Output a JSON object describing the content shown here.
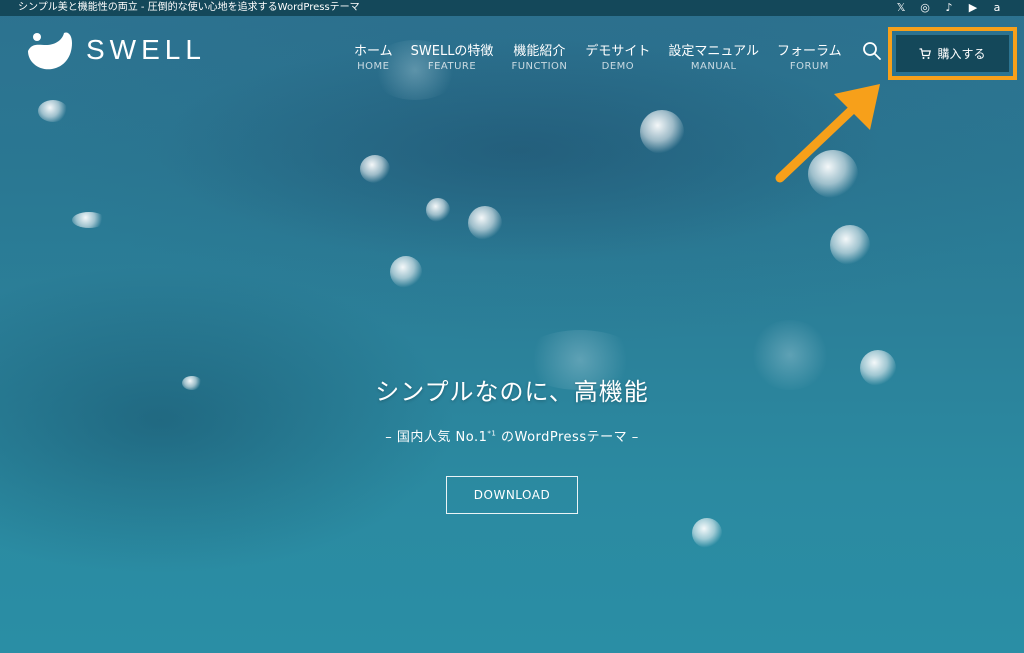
{
  "topbar": {
    "tagline": "シンプル美と機能性の両立 - 圧倒的な使い心地を追求するWordPressテーマ",
    "socials": [
      {
        "icon": "x-icon",
        "glyph": "𝕏"
      },
      {
        "icon": "instagram-icon",
        "glyph": "◎"
      },
      {
        "icon": "tiktok-icon",
        "glyph": "♪"
      },
      {
        "icon": "youtube-icon",
        "glyph": "▶"
      },
      {
        "icon": "amazon-icon",
        "glyph": "a"
      }
    ]
  },
  "header": {
    "logo_text": "SWELL",
    "nav": [
      {
        "jp": "ホーム",
        "en": "HOME"
      },
      {
        "jp": "SWELLの特徴",
        "en": "FEATURE"
      },
      {
        "jp": "機能紹介",
        "en": "FUNCTION"
      },
      {
        "jp": "デモサイト",
        "en": "DEMO"
      },
      {
        "jp": "設定マニュアル",
        "en": "MANUAL"
      },
      {
        "jp": "フォーラム",
        "en": "FORUM"
      }
    ],
    "buy_label": "購入する"
  },
  "hero": {
    "title": "シンプルなのに、高機能",
    "subtitle_pre": "– 国内人気 No.1",
    "subtitle_sup": "*1",
    "subtitle_post": " のWordPressテーマ –",
    "download_label": "DOWNLOAD"
  },
  "colors": {
    "accent": "#f7a01a",
    "header_bg": "#14485a",
    "ocean": "#2b8099"
  }
}
